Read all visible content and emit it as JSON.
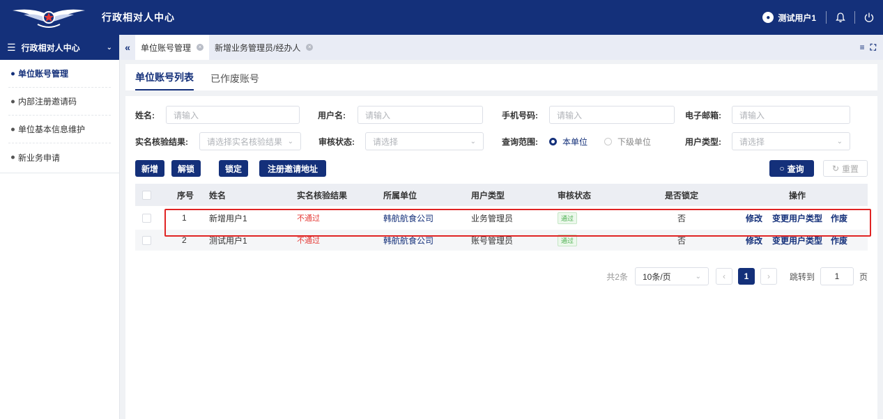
{
  "header": {
    "app_title": "行政相对人中心",
    "user_name": "测试用户1"
  },
  "sidebar": {
    "title": "行政相对人中心",
    "items": [
      {
        "label": "单位账号管理",
        "active": true
      },
      {
        "label": "内部注册邀请码",
        "active": false
      },
      {
        "label": "单位基本信息维护",
        "active": false
      },
      {
        "label": "新业务申请",
        "active": false
      }
    ]
  },
  "tabs": [
    {
      "label": "单位账号管理",
      "active": true
    },
    {
      "label": "新增业务管理员/经办人",
      "active": false
    }
  ],
  "panel_tabs": [
    {
      "label": "单位账号列表",
      "active": true
    },
    {
      "label": "已作废账号",
      "active": false
    }
  ],
  "filters": {
    "name_label": "姓名:",
    "name_placeholder": "请输入",
    "username_label": "用户名:",
    "username_placeholder": "请输入",
    "phone_label": "手机号码:",
    "phone_placeholder": "请输入",
    "email_label": "电子邮箱:",
    "email_placeholder": "请输入",
    "verify_label": "实名核验结果:",
    "verify_placeholder": "请选择实名核验结果",
    "audit_label": "审核状态:",
    "audit_placeholder": "请选择",
    "scope_label": "查询范围:",
    "scope_options": [
      "本单位",
      "下级单位"
    ],
    "scope_selected": "本单位",
    "usertype_label": "用户类型:",
    "usertype_placeholder": "请选择"
  },
  "actions": {
    "add": "新增",
    "unlock": "解锁",
    "lock": "锁定",
    "invite": "注册邀请地址",
    "search": "查询",
    "reset": "重置"
  },
  "table": {
    "columns": [
      "序号",
      "姓名",
      "实名核验结果",
      "所属单位",
      "用户类型",
      "审核状态",
      "是否锁定",
      "操作"
    ],
    "rows": [
      {
        "index": "1",
        "name": "新增用户1",
        "verify": "不通过",
        "unit": "韩航航食公司",
        "type": "业务管理员",
        "audit": "通过",
        "locked": "否",
        "ops": [
          "修改",
          "变更用户类型",
          "作废"
        ]
      },
      {
        "index": "2",
        "name": "测试用户1",
        "verify": "不通过",
        "unit": "韩航航食公司",
        "type": "账号管理员",
        "audit": "通过",
        "locked": "否",
        "ops": [
          "修改",
          "变更用户类型",
          "作废"
        ]
      }
    ]
  },
  "pagination": {
    "total": "共2条",
    "page_size": "10条/页",
    "current_page": "1",
    "jump_label": "跳转到",
    "jump_value": "1",
    "page_suffix": "页"
  },
  "colors": {
    "primary": "#14307a",
    "danger": "#e53935",
    "success": "#4caf50",
    "highlight": "#e02424"
  }
}
